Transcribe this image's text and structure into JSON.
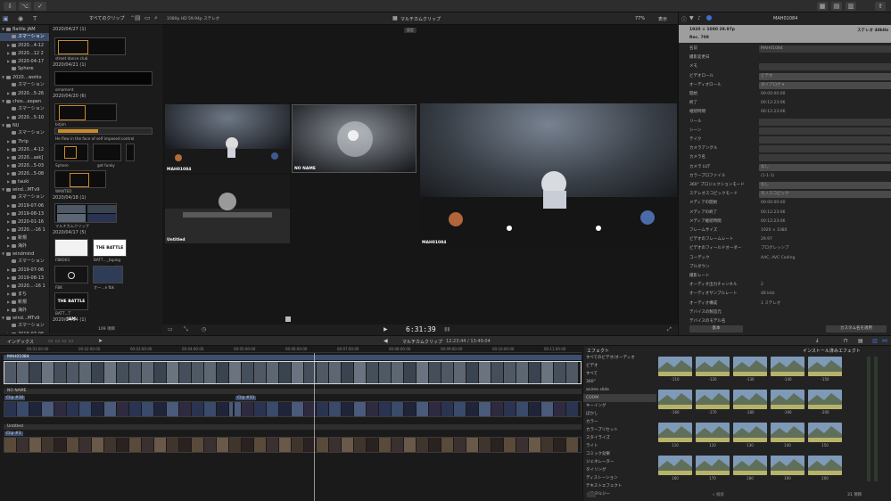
{
  "toolbar": {
    "clip_filter": "すべてのクリップ",
    "viewer_format": "1080p HD 59.94p ステレオ",
    "angle_title": "マルチカムクリップ",
    "zoom": "77%",
    "view_menu": "表示",
    "inspector_name": "MAH01084"
  },
  "sidebar": {
    "items": [
      {
        "label": "Battle JAM",
        "level": 0,
        "tri": "▼"
      },
      {
        "label": "スマーション",
        "level": 1,
        "tri": "",
        "selected": true
      },
      {
        "label": "2020…4-12",
        "level": 1,
        "tri": "▶"
      },
      {
        "label": "2020…12 2",
        "level": 1,
        "tri": "▶"
      },
      {
        "label": "2020-04-17",
        "level": 1,
        "tri": "▶"
      },
      {
        "label": "Sphere",
        "level": 1,
        "tri": ""
      },
      {
        "label": "2020…works",
        "level": 0,
        "tri": "▼"
      },
      {
        "label": "スマーション",
        "level": 1,
        "tri": ""
      },
      {
        "label": "2020…5-26",
        "level": 1,
        "tri": "▶"
      },
      {
        "label": "chos…eopen",
        "level": 0,
        "tri": "▼"
      },
      {
        "label": "スマーション",
        "level": 1,
        "tri": ""
      },
      {
        "label": "2020…5-10",
        "level": 1,
        "tri": "▶"
      },
      {
        "label": "NU",
        "level": 0,
        "tri": "▼"
      },
      {
        "label": "スマーション",
        "level": 1,
        "tri": ""
      },
      {
        "label": "7trip",
        "level": 1,
        "tri": "▶"
      },
      {
        "label": "2020…4-12",
        "level": 1,
        "tri": "▶"
      },
      {
        "label": "2020…ask]",
        "level": 1,
        "tri": "▶"
      },
      {
        "label": "2020…5-03",
        "level": 1,
        "tri": "▶"
      },
      {
        "label": "2020…5-08",
        "level": 1,
        "tri": "▶"
      },
      {
        "label": "tauki",
        "level": 1,
        "tri": "▶"
      },
      {
        "label": "wind…MTv9",
        "level": 0,
        "tri": "▼"
      },
      {
        "label": "スマーション",
        "level": 1,
        "tri": ""
      },
      {
        "label": "2019-07-06",
        "level": 1,
        "tri": "▶"
      },
      {
        "label": "2019-08-13",
        "level": 1,
        "tri": "▶"
      },
      {
        "label": "2020-01-16",
        "level": 1,
        "tri": "▶"
      },
      {
        "label": "2020…-16 1",
        "level": 1,
        "tri": "▶"
      },
      {
        "label": "新規",
        "level": 1,
        "tri": "▶"
      },
      {
        "label": "海外",
        "level": 1,
        "tri": "▶"
      },
      {
        "label": "windmind",
        "level": 0,
        "tri": "▼"
      },
      {
        "label": "スマーション",
        "level": 1,
        "tri": ""
      },
      {
        "label": "2019-07-06",
        "level": 1,
        "tri": "▶"
      },
      {
        "label": "2019-08-13",
        "level": 1,
        "tri": "▶"
      },
      {
        "label": "2020…-16 1",
        "level": 1,
        "tri": "▶"
      },
      {
        "label": "まち",
        "level": 1,
        "tri": "▶"
      },
      {
        "label": "新規",
        "level": 1,
        "tri": "▶"
      },
      {
        "label": "海外",
        "level": 1,
        "tri": "▶"
      },
      {
        "label": "wind…MTv9",
        "level": 0,
        "tri": "▼"
      },
      {
        "label": "スマーション",
        "level": 1,
        "tri": ""
      },
      {
        "label": "2019-07-06",
        "level": 1,
        "tri": "▶"
      }
    ]
  },
  "browser": {
    "dates": [
      "2020/04/27 (1)",
      "2020/04/21 (1)",
      "2020/04/20 (6)",
      "2020/04/18 (1)",
      "2020/04/17 (5)",
      "2020/04/14 (1)"
    ],
    "captions": [
      "street dance club",
      "ornament",
      "bitjim",
      "He flew in the face of self imposed control",
      "Sphere",
      "get funky",
      "WANTED",
      "マルチカムクリップ",
      "FBK003",
      "BATT…_taping",
      "FBK",
      "オー…e fbk",
      "BATT…T"
    ],
    "badge": "THE BATTLE JAM",
    "status": "109 項目"
  },
  "viewer": {
    "angles": [
      "MAH01084",
      "NO NAME",
      "Untitled"
    ],
    "main_label": "MAH01084",
    "timecode": "6:31:39"
  },
  "inspector": {
    "header": {
      "res": "1920 × 1080 29.97p",
      "rate": "Rec. 709",
      "audio": "ステレオ 48kHz"
    },
    "rows": [
      {
        "label": "名前",
        "value": "MAH01084",
        "kind": "box"
      },
      {
        "label": "撮影変更日",
        "value": "",
        "kind": "none"
      },
      {
        "label": "メモ",
        "value": "",
        "kind": "box"
      },
      {
        "label": "ビデオロール",
        "value": "ビデオ",
        "kind": "sel"
      },
      {
        "label": "オーディオロール",
        "value": "ダイアログ ▾",
        "kind": "sel"
      },
      {
        "label": "開始",
        "value": "00:00:00:00",
        "kind": "none"
      },
      {
        "label": "終了",
        "value": "00:12:23:06",
        "kind": "none"
      },
      {
        "label": "継続時間",
        "value": "00:12:23:06",
        "kind": "none"
      },
      {
        "label": "リール",
        "value": "",
        "kind": "box"
      },
      {
        "label": "シーン",
        "value": "",
        "kind": "box"
      },
      {
        "label": "テイク",
        "value": "",
        "kind": "box"
      },
      {
        "label": "カメラアングル",
        "value": "",
        "kind": "box"
      },
      {
        "label": "カメラ名",
        "value": "",
        "kind": "box"
      },
      {
        "label": "カメラ LUT",
        "value": "なし",
        "kind": "sel"
      },
      {
        "label": "カラープロファイル",
        "value": "(1-1-1)",
        "kind": "none"
      },
      {
        "label": "360° プロジェクションモード",
        "value": "なし",
        "kind": "sel"
      },
      {
        "label": "ステレオスコピックモード",
        "value": "モノスコピック",
        "kind": "sel"
      },
      {
        "label": "メディアの開始",
        "value": "00:00:00:00",
        "kind": "none"
      },
      {
        "label": "メディアの終了",
        "value": "00:12:23:06",
        "kind": "none"
      },
      {
        "label": "メディア継続時間",
        "value": "00:12:23:06",
        "kind": "none"
      },
      {
        "label": "フレームサイズ",
        "value": "1920 × 1080",
        "kind": "none"
      },
      {
        "label": "ビデオのフレームレート",
        "value": "29.97",
        "kind": "none"
      },
      {
        "label": "ビデオのフィールドオーダー",
        "value": "プログレッシブ",
        "kind": "none"
      },
      {
        "label": "コーデック",
        "value": "AAC, AVC Coding",
        "kind": "none"
      },
      {
        "label": "プルダウン",
        "value": "",
        "kind": "none"
      },
      {
        "label": "撮影レート",
        "value": "",
        "kind": "none"
      },
      {
        "label": "オーディオ出力チャンネル",
        "value": "2",
        "kind": "none"
      },
      {
        "label": "オーディオサンプルレート",
        "value": "48 kHz",
        "kind": "none"
      },
      {
        "label": "オーディオ構成",
        "value": "1 ステレオ",
        "kind": "none"
      },
      {
        "label": "デバイスの製造元",
        "value": "",
        "kind": "none"
      },
      {
        "label": "デバイスのモデル名",
        "value": "",
        "kind": "none"
      }
    ],
    "footer_left": "基本",
    "footer_right": "カスタム名を適用"
  },
  "timeline": {
    "index_label": "インデックス",
    "project": "マルチカムクリップ",
    "duration": "12:23:44 / 13:49:04",
    "ruler": [
      "00:01:00:00",
      "00:02:00:00",
      "00:03:00:00",
      "00:04:00:00",
      "00:05:00:00",
      "00:06:00:00",
      "00:07:00:00",
      "00:08:00:00",
      "00:09:00:00",
      "00:10:00:00",
      "00:11:00:00"
    ],
    "tracks": [
      {
        "name": "MAH01084"
      },
      {
        "name": "NO NAME",
        "clips": [
          "Clip #30",
          "Clip #31"
        ]
      },
      {
        "name": "Untitled",
        "clips": [
          "Clip #3"
        ]
      }
    ]
  },
  "effects": {
    "title": "エフェクト",
    "installed": "インストール済みエフェクト",
    "categories": [
      "すべてのビデオ/オーディオ",
      "ビデオ",
      "すべて",
      "360°",
      "anime slide",
      "COOM",
      "キーイング",
      "ぼかし",
      "カラー",
      "カラープリセット",
      "スタイライズ",
      "ライト",
      "コミック効果",
      "ジェネレーター",
      "タイリング",
      "ディストーション",
      "テキストエフェクト",
      "ノスタルジー"
    ],
    "selected_index": 5,
    "tiles": [
      "-110",
      "-120",
      "-130",
      "-140",
      "-150",
      "-160",
      "-170",
      "-180",
      "-190",
      "-200",
      "110",
      "120",
      "130",
      "140",
      "150",
      "160",
      "170",
      "180",
      "190",
      "200"
    ],
    "count": "31 項目",
    "search_placeholder": "検索"
  },
  "colors": {
    "accent": "#3b6fd6",
    "selection": "#3b4a66",
    "yellow": "#e6c94b"
  }
}
